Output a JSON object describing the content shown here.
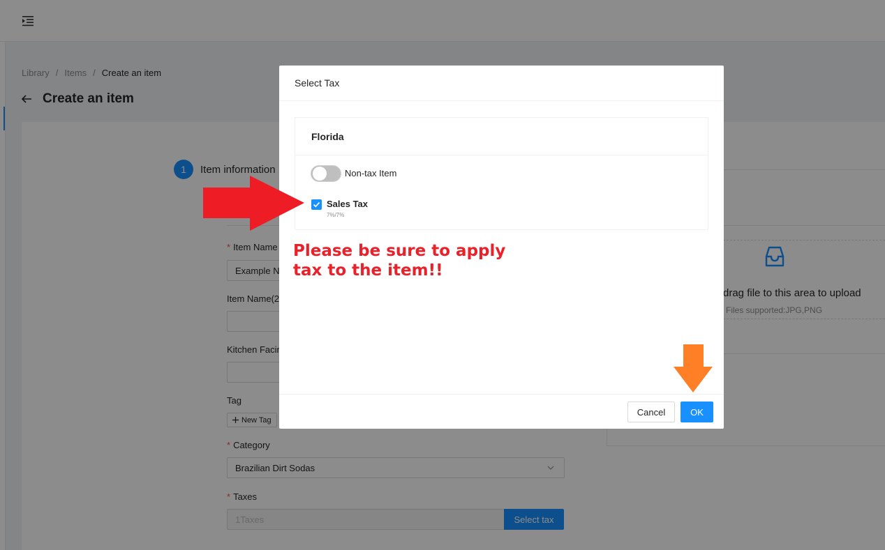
{
  "breadcrumb": {
    "items": [
      "Library",
      "Items",
      "Create an item"
    ],
    "separator": "/"
  },
  "page": {
    "title": "Create an item"
  },
  "steps": [
    {
      "number": "1",
      "title": "Item information"
    }
  ],
  "form": {
    "item_name_label": "Item Name",
    "item_name_value": "Example Na",
    "item_name2_label": "Item Name(2",
    "kitchen_label": "Kitchen Facin",
    "tag_label": "Tag",
    "new_tag_label": "New Tag",
    "category_label": "Category",
    "category_value": "Brazilian Dirt Sodas",
    "taxes_label": "Taxes",
    "taxes_placeholder": "1Taxes",
    "select_tax_label": "Select tax"
  },
  "upload": {
    "text": "drag file to this area to upload",
    "hint": "Files supported:JPG,PNG"
  },
  "modal": {
    "title": "Select Tax",
    "region": "Florida",
    "non_tax_label": "Non-tax Item",
    "non_tax_enabled": false,
    "tax_option": {
      "label": "Sales Tax",
      "rate": "7%/7%",
      "checked": true
    },
    "cancel_label": "Cancel",
    "ok_label": "OK"
  },
  "annotation": {
    "line1": "Please be sure to apply",
    "line2": "tax to the item!!",
    "color": "#e8212b"
  },
  "colors": {
    "primary": "#1890ff",
    "required": "#ff4d4f",
    "red_arrow": "#ee1c25",
    "orange_arrow": "#ff7f27"
  },
  "icons": {
    "menu": "menu-fold-icon",
    "back": "arrow-left-icon",
    "upload": "inbox-icon",
    "select": "chevron-down-icon",
    "check": "check-icon",
    "plus": "plus-icon"
  }
}
